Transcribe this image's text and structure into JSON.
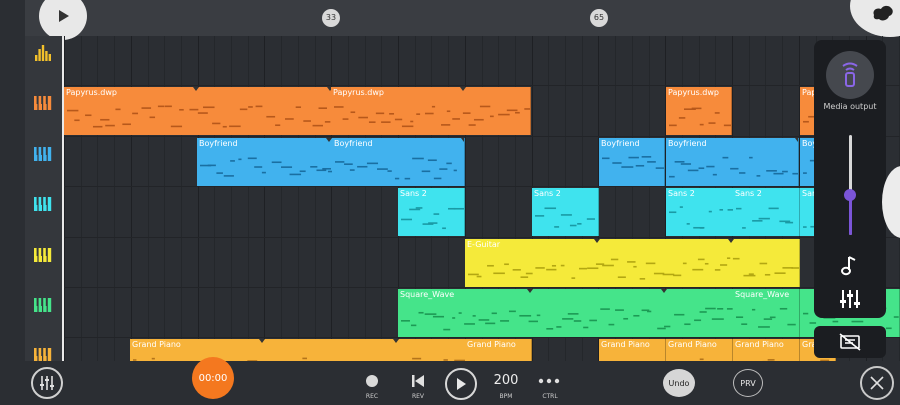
{
  "timeline": {
    "markers": [
      "33",
      "65"
    ]
  },
  "tracks": [
    {
      "name": "meters",
      "color": "#f3c12b"
    },
    {
      "name": "Papyrus.dwp",
      "color": "#f78b3b"
    },
    {
      "name": "Boyfriend",
      "color": "#41b2ee"
    },
    {
      "name": "Sans 2",
      "color": "#3fe3ee"
    },
    {
      "name": "E-Guitar",
      "color": "#f5ea3a"
    },
    {
      "name": "Square_Wave",
      "color": "#45e48a"
    },
    {
      "name": "Grand Piano",
      "color": "#f7b33a"
    }
  ],
  "clips": [
    {
      "track": 1,
      "label": "Papyrus.dwp",
      "color": "#f78b3b",
      "dark": "#b7581b"
    },
    {
      "track": 1,
      "label": "Papyrus.dwp",
      "color": "#f78b3b",
      "dark": "#b7581b"
    },
    {
      "track": 1,
      "label": "Papyrus.dwp",
      "color": "#f78b3b",
      "dark": "#b7581b"
    },
    {
      "track": 1,
      "label": "Papyrus.dwp",
      "color": "#f78b3b",
      "dark": "#b7581b"
    },
    {
      "track": 1,
      "label": "Papyrus.dwp",
      "color": "#f78b3b",
      "dark": "#b7581b"
    },
    {
      "track": 2,
      "label": "Boyfriend",
      "color": "#41b2ee",
      "dark": "#1a6fa2"
    },
    {
      "track": 2,
      "label": "Boyfriend",
      "color": "#41b2ee",
      "dark": "#1a6fa2"
    },
    {
      "track": 2,
      "label": "Boyfriend",
      "color": "#41b2ee",
      "dark": "#1a6fa2"
    },
    {
      "track": 2,
      "label": "Boyfriend",
      "color": "#41b2ee",
      "dark": "#1a6fa2"
    },
    {
      "track": 2,
      "label": "Boyfriend",
      "color": "#41b2ee",
      "dark": "#1a6fa2"
    },
    {
      "track": 3,
      "label": "Sans 2",
      "color": "#3fe3ee",
      "dark": "#1a9aa5"
    },
    {
      "track": 3,
      "label": "Sans 2",
      "color": "#3fe3ee",
      "dark": "#1a9aa5"
    },
    {
      "track": 3,
      "label": "Sans 2",
      "color": "#3fe3ee",
      "dark": "#1a9aa5"
    },
    {
      "track": 3,
      "label": "Sans 2",
      "color": "#3fe3ee",
      "dark": "#1a9aa5"
    },
    {
      "track": 3,
      "label": "Sans 2",
      "color": "#3fe3ee",
      "dark": "#1a9aa5"
    },
    {
      "track": 4,
      "label": "E-Guitar",
      "color": "#f5ea3a",
      "dark": "#b3a712"
    },
    {
      "track": 5,
      "label": "Square_Wave",
      "color": "#45e48a",
      "dark": "#1d9a55"
    },
    {
      "track": 5,
      "label": "Square_Wave",
      "color": "#45e48a",
      "dark": "#1d9a55"
    },
    {
      "track": 5,
      "label": "",
      "color": "#45e48a",
      "dark": "#1d9a55"
    },
    {
      "track": 6,
      "label": "Grand Piano",
      "color": "#f7b33a",
      "dark": "#b4741a"
    },
    {
      "track": 6,
      "label": "Grand Piano",
      "color": "#f7b33a",
      "dark": "#b4741a"
    },
    {
      "track": 6,
      "label": "Grand Piano",
      "color": "#f7b33a",
      "dark": "#b4741a"
    },
    {
      "track": 6,
      "label": "Grand Piano",
      "color": "#f7b33a",
      "dark": "#b4741a"
    },
    {
      "track": 6,
      "label": "Grand Piano",
      "color": "#f7b33a",
      "dark": "#b4741a"
    },
    {
      "track": 6,
      "label": "Grand Piano",
      "color": "#f7b33a",
      "dark": "#b4741a"
    }
  ],
  "side_panel": {
    "media_label": "Media output",
    "volume_level": 0.4,
    "accent": "#7b55d8"
  },
  "bottom": {
    "time": "00:00",
    "rec": "REC",
    "rev": "REV",
    "bpm": "200",
    "bpm_label": "BPM",
    "ctrl": "CTRL",
    "undo": "Undo",
    "prv": "PRV",
    "time_color": "#f4781f"
  }
}
